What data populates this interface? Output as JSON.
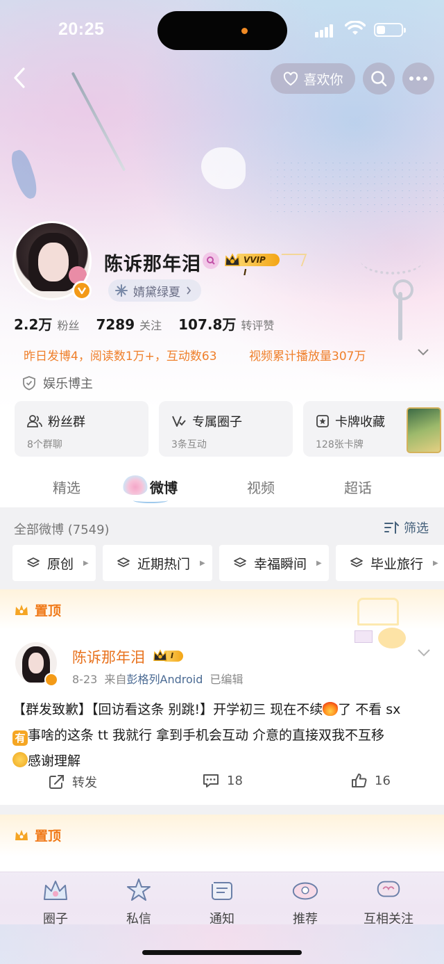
{
  "status_bar": {
    "time": "20:25"
  },
  "header": {
    "like_button_label": "喜欢你",
    "back_icon": "chevron-left-icon",
    "search_icon": "search-icon",
    "more_icon": "more-dots-icon"
  },
  "profile": {
    "name": "陈诉那年泪",
    "vip_label": "VVIP I",
    "fan_group_name": "婧黛绿夏",
    "stats": [
      {
        "num": "2.2万",
        "label": "粉丝"
      },
      {
        "num": "7289",
        "label": "关注"
      },
      {
        "num": "107.8万",
        "label": "转评赞"
      }
    ],
    "highlight_1": "昨日发博4，阅读数1万+，互动数63",
    "highlight_2": "视频累计播放量307万",
    "role_tag": "娱乐博主"
  },
  "cards": [
    {
      "title": "粉丝群",
      "sub": "8个群聊"
    },
    {
      "title": "专属圈子",
      "sub": "3条互动"
    },
    {
      "title": "卡牌收藏",
      "sub": "128张卡牌"
    }
  ],
  "tabs": [
    "精选",
    "微博",
    "视频",
    "超话"
  ],
  "filter": {
    "count_label": "全部微博 (7549)",
    "filter_label": "筛选",
    "chips": [
      "原创",
      "近期热门",
      "幸福瞬间",
      "毕业旅行"
    ]
  },
  "pinned_label": "置顶",
  "post": {
    "author": "陈诉那年泪",
    "vip_level": "I",
    "date": "8-23",
    "source_prefix": "来自",
    "source": "彭格列Android",
    "edited": "已编辑",
    "text_1": "【群发致歉】【回访看这条 别跳!】开学初三 现在不续",
    "text_2": "了 不看 sx",
    "you_char": "有",
    "text_3": "事啥的这条 tt 我就行 拿到手机会互动 介意的直接双我不互移",
    "text_4": "感谢理解",
    "repost_label": "转发",
    "comments": "18",
    "likes": "16"
  },
  "bottom_nav": [
    "圈子",
    "私信",
    "通知",
    "推荐",
    "互相关注"
  ],
  "colors": {
    "accent_orange": "#f07a19",
    "link_blue": "#4a6a93",
    "vip_gold": "#f3a515"
  }
}
